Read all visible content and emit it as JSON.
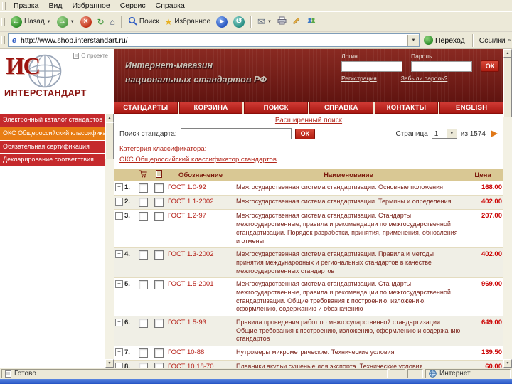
{
  "browser": {
    "menu": [
      "Правка",
      "Вид",
      "Избранное",
      "Сервис",
      "Справка"
    ],
    "toolbar": {
      "back": "Назад",
      "search": "Поиск",
      "favorites": "Избранное"
    },
    "address": {
      "url": "http://www.shop.interstandart.ru/",
      "go": "Переход",
      "links": "Ссылки"
    },
    "status": {
      "ready": "Готово",
      "zone": "Интернет"
    }
  },
  "site": {
    "logo": {
      "monogram": "ИС",
      "brand": "ИНТЕРСТАНДАРТ",
      "about": "О проекте"
    },
    "masthead": {
      "title_line1": "Интернет-магазин",
      "title_line2": "национальных стандартов РФ",
      "login_label": "Логин",
      "password_label": "Пароль",
      "ok": "ОК",
      "register": "Регистрация",
      "forgot": "Забыли пароль?"
    },
    "nav": [
      "СТАНДАРТЫ",
      "КОРЗИНА",
      "ПОИСК",
      "СПРАВКА",
      "КОНТАКТЫ",
      "ENGLISH"
    ],
    "sidebar": [
      {
        "label": "Электронный каталог стандартов",
        "active": false
      },
      {
        "label": "ОКС Общероссийский классификатор",
        "active": true
      },
      {
        "label": "Обязательная сертификация",
        "active": false
      },
      {
        "label": "Декларирование соответствия",
        "active": false
      }
    ],
    "search": {
      "advanced": "Расширенный поиск",
      "label": "Поиск стандарта:",
      "value": "",
      "ok": "ОК",
      "page_label": "Страница",
      "page_value": "1",
      "pages_total": "из 1574"
    },
    "category": {
      "label": "Категория классификатора:",
      "value": "ОКС Общероссийский классификатор стандартов"
    },
    "table": {
      "headers": {
        "designation": "Обозначение",
        "name": "Наименование",
        "price": "Цена"
      },
      "rows": [
        {
          "num": "1.",
          "code": "ГОСТ 1.0-92",
          "name": "Межгосударственная система стандартизации. Основные положения",
          "price": "168.00"
        },
        {
          "num": "2.",
          "code": "ГОСТ 1.1-2002",
          "name": "Межгосударственная система стандартизации. Термины и определения",
          "price": "402.00"
        },
        {
          "num": "3.",
          "code": "ГОСТ 1.2-97",
          "name": "Межгосударственная система стандартизации. Стандарты межгосударственные, правила и рекомендации по межгосударственной стандартизации. Порядок разработки, принятия, применения, обновления и отмены",
          "price": "207.00"
        },
        {
          "num": "4.",
          "code": "ГОСТ 1.3-2002",
          "name": "Межгосударственная система стандартизации. Правила и методы принятия международных и региональных стандартов в качестве межгосударственных стандартов",
          "price": "402.00"
        },
        {
          "num": "5.",
          "code": "ГОСТ 1.5-2001",
          "name": "Межгосударственная система стандартизации. Стандарты межгосударственные, правила и рекомендации по межгосударственной стандартизации. Общие требования к построению, изложению, оформлению, содержанию и обозначению",
          "price": "969.00"
        },
        {
          "num": "6.",
          "code": "ГОСТ 1.5-93",
          "name": "Правила проведения работ по межгосударственной стандартизации. Общие требования к построению, изложению, оформлению и содержанию стандартов",
          "price": "649.00"
        },
        {
          "num": "7.",
          "code": "ГОСТ 10-88",
          "name": "Нутромеры микрометрические. Технические условия",
          "price": "139.50"
        },
        {
          "num": "8.",
          "code": "ГОСТ 10.18-70",
          "name": "Плавники акульи сушеные для экспорта. Технические условия",
          "price": "60.00"
        }
      ]
    }
  }
}
